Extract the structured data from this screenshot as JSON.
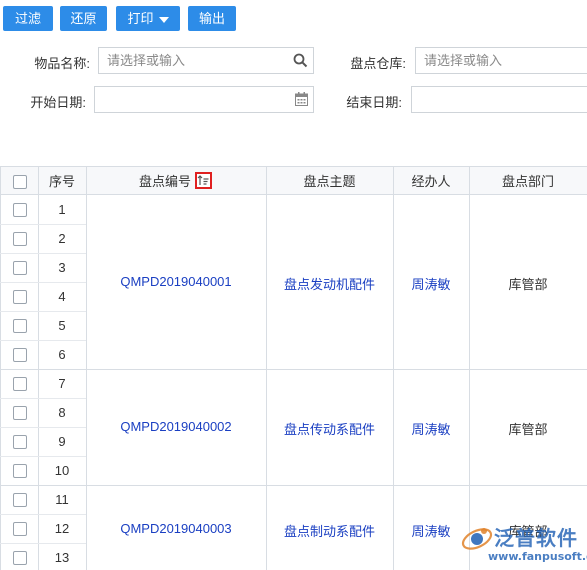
{
  "toolbar": {
    "filter_label": "过滤",
    "reset_label": "还原",
    "print_label": "打印",
    "export_label": "输出",
    "accent_color": "#2d8ce8"
  },
  "filters": {
    "item_name": {
      "label": "物品名称:",
      "placeholder": "请选择或输入"
    },
    "warehouse": {
      "label": "盘点仓库:",
      "placeholder": "请选择或输入"
    },
    "start_date": {
      "label": "开始日期:",
      "value": ""
    },
    "end_date": {
      "label": "结束日期:",
      "value": ""
    }
  },
  "table": {
    "columns": {
      "seq": "序号",
      "code": "盘点编号",
      "subject": "盘点主题",
      "handler": "经办人",
      "dept": "盘点部门"
    },
    "row_numbers": [
      "1",
      "2",
      "3",
      "4",
      "5",
      "6",
      "7",
      "8",
      "9",
      "10",
      "11",
      "12",
      "13"
    ],
    "groups": [
      {
        "code": "QMPD2019040001",
        "subject": "盘点发动机配件",
        "handler": "周涛敏",
        "dept": "库管部"
      },
      {
        "code": "QMPD2019040002",
        "subject": "盘点传动系配件",
        "handler": "周涛敏",
        "dept": "库管部"
      },
      {
        "code": "QMPD2019040003",
        "subject": "盘点制动系配件",
        "handler": "周涛敏",
        "dept": "库管部"
      }
    ]
  },
  "watermark": {
    "brand": "泛普软件",
    "url": "www.fanpusoft.com"
  }
}
